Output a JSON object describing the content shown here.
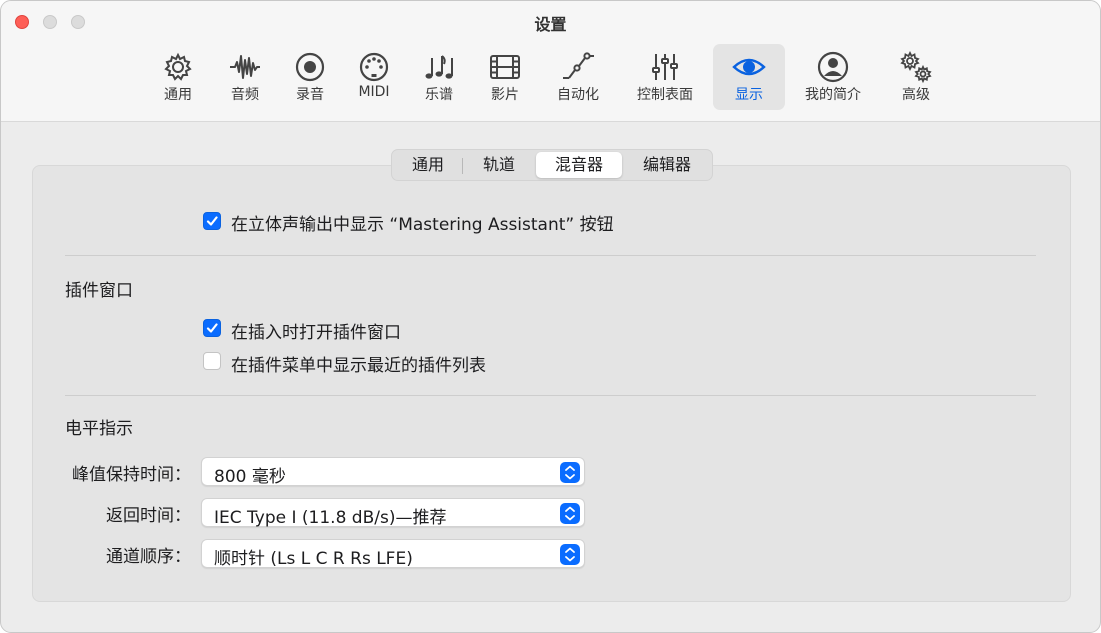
{
  "window": {
    "title": "设置"
  },
  "toolbar": [
    {
      "key": "general",
      "label": "通用",
      "icon": "gear-icon"
    },
    {
      "key": "audio",
      "label": "音频",
      "icon": "waveform-icon"
    },
    {
      "key": "recording",
      "label": "录音",
      "icon": "record-icon"
    },
    {
      "key": "midi",
      "label": "MIDI",
      "icon": "midi-port-icon"
    },
    {
      "key": "score",
      "label": "乐谱",
      "icon": "music-notes-icon"
    },
    {
      "key": "movie",
      "label": "影片",
      "icon": "film-icon"
    },
    {
      "key": "automation",
      "label": "自动化",
      "icon": "automation-curve-icon"
    },
    {
      "key": "control_surfaces",
      "label": "控制表面",
      "icon": "sliders-icon"
    },
    {
      "key": "display",
      "label": "显示",
      "icon": "eye-icon",
      "active": true
    },
    {
      "key": "my_info",
      "label": "我的简介",
      "icon": "person-icon"
    },
    {
      "key": "advanced",
      "label": "高级",
      "icon": "gears-icon"
    }
  ],
  "tabs": [
    {
      "label": "通用"
    },
    {
      "label": "轨道"
    },
    {
      "label": "混音器",
      "active": true
    },
    {
      "label": "编辑器"
    }
  ],
  "mixer": {
    "mastering_assistant": {
      "label": "在立体声输出中显示 “Mastering Assistant” 按钮",
      "checked": true
    },
    "plugin_window": {
      "title": "插件窗口",
      "open_on_insert": {
        "label": "在插入时打开插件窗口",
        "checked": true
      },
      "show_recent": {
        "label": "在插件菜单中显示最近的插件列表",
        "checked": false
      }
    },
    "level_meter": {
      "title": "电平指示",
      "peak_hold": {
        "label": "峰值保持时间：",
        "value": "800 毫秒"
      },
      "return_time": {
        "label": "返回时间：",
        "value": "IEC Type I (11.8 dB/s)—推荐"
      },
      "channel_order": {
        "label": "通道顺序：",
        "value": "顺时针 (Ls L C R Rs LFE)"
      }
    }
  },
  "colors": {
    "accent": "#0a6cff",
    "close": "#fe5f57"
  }
}
